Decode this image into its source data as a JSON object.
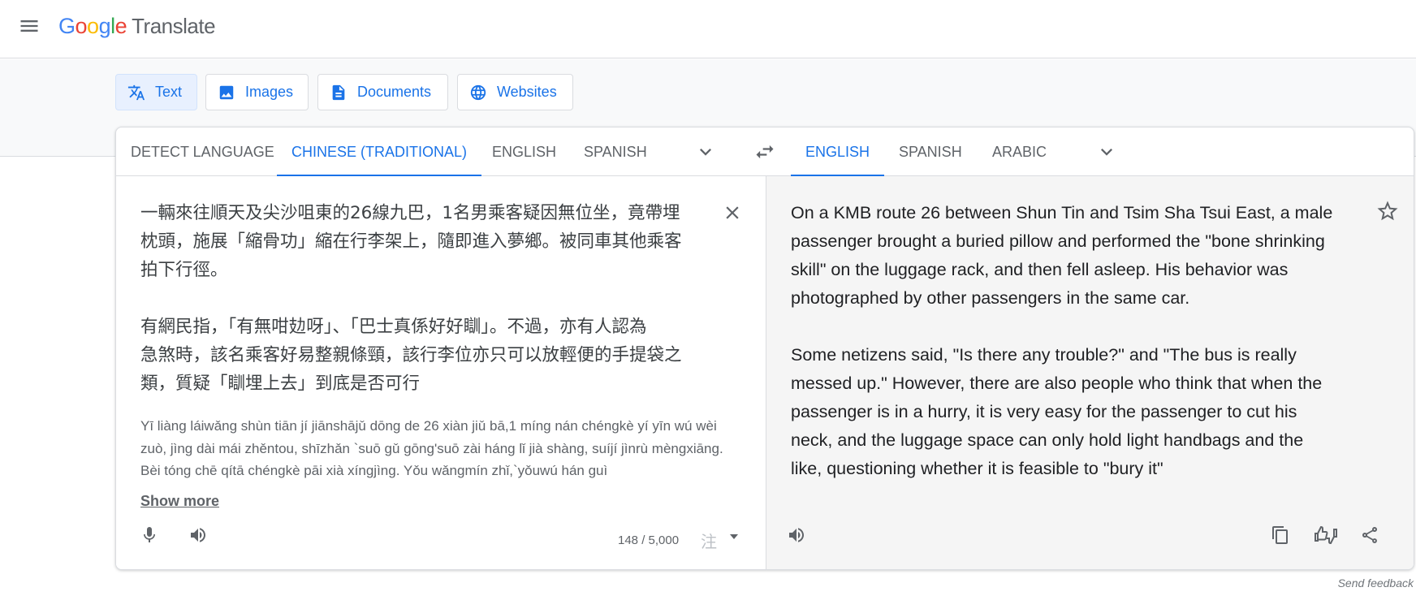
{
  "header": {
    "logo_letters": [
      "G",
      "o",
      "o",
      "g",
      "l",
      "e"
    ],
    "product": "Translate"
  },
  "modes": [
    {
      "label": "Text",
      "icon": "translate-icon",
      "active": true
    },
    {
      "label": "Images",
      "icon": "image-icon",
      "active": false
    },
    {
      "label": "Documents",
      "icon": "document-icon",
      "active": false
    },
    {
      "label": "Websites",
      "icon": "globe-icon",
      "active": false
    }
  ],
  "source_langs": [
    "DETECT LANGUAGE",
    "CHINESE (TRADITIONAL)",
    "ENGLISH",
    "SPANISH"
  ],
  "source_active": "CHINESE (TRADITIONAL)",
  "target_langs": [
    "ENGLISH",
    "SPANISH",
    "ARABIC"
  ],
  "target_active": "ENGLISH",
  "source": {
    "text": "一輛來往順天及尖沙咀東的26線九巴，1名男乘客疑因無位坐，竟帶埋\n枕頭，施展「縮骨功」縮在行李架上，隨即進入夢鄉。被同車其他乘客\n拍下行徑。\n\n有網民指，「有無咁攰呀」、「巴士真係好好瞓」。不過，亦有人認為\n急煞時，該名乘客好易整親條頸，該行李位亦只可以放輕便的手提袋之\n類，質疑「瞓埋上去」到底是否可行",
    "transliteration": "Yī liàng láiwǎng shùn tiān jí jiānshājǔ dōng de 26 xiàn jiǔ bā,1 míng nán chéngkè yí yīn wú wèi zuò, jìng dài mái zhěntou, shīzhǎn `suō gǔ gōng'suō zài háng lǐ jià shàng, suíjí jìnrù mèngxiāng. Bèi tóng chē qítā chéngkè pāi xià xíngjìng. Yǒu wǎngmín zhǐ,`yǒuwú hán guì",
    "show_more": "Show more",
    "char_count": "148 / 5,000",
    "ime_char": "注"
  },
  "target": {
    "text": "On a KMB route 26 between Shun Tin and Tsim Sha Tsui East, a male\npassenger brought a buried pillow and performed the \"bone shrinking\nskill\" on the luggage rack, and then fell asleep. His behavior was\nphotographed by other passengers in the same car.\n\nSome netizens said, \"Is there any trouble?\" and \"The bus is really\nmessed up.\" However, there are also people who think that when the\npassenger is in a hurry, it is very easy for the passenger to cut his\nneck, and the luggage space can only hold light handbags and the\nlike, questioning whether it is feasible to \"bury it\""
  },
  "footer": {
    "send_feedback": "Send feedback"
  },
  "colors": {
    "accent": "#1a73e8",
    "target_bg": "#f5f5f5",
    "icon": "#5f6368"
  }
}
